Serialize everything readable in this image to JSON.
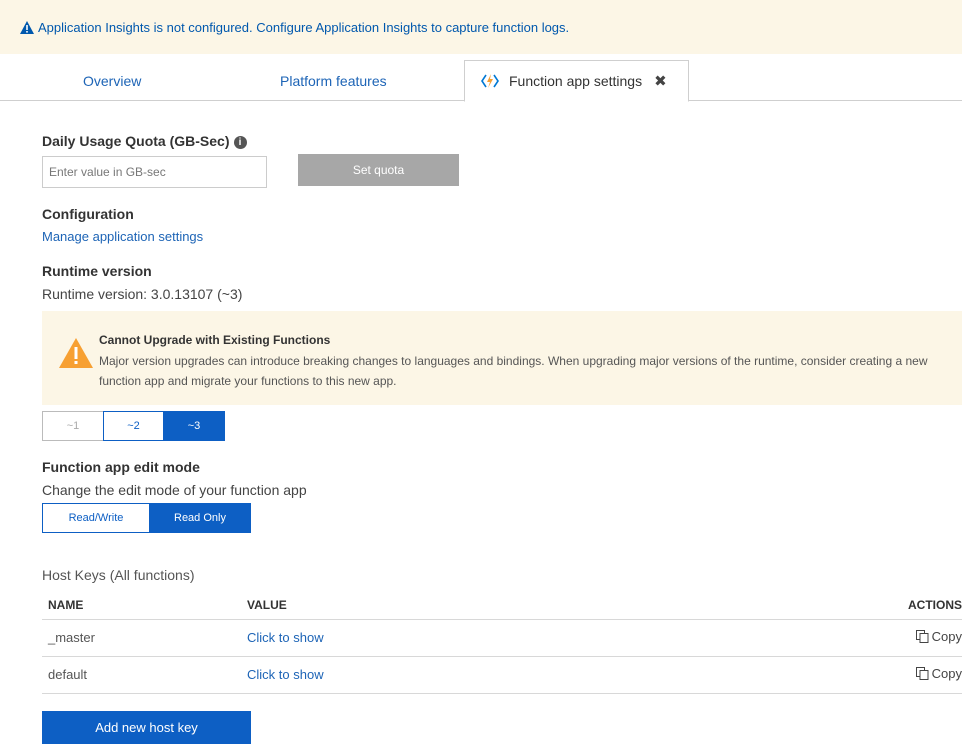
{
  "banner": {
    "text": "Application Insights is not configured. Configure Application Insights to capture function logs.",
    "icon": "warning-icon"
  },
  "tabs": [
    {
      "label": "Overview"
    },
    {
      "label": "Platform features"
    },
    {
      "label": "Function app settings",
      "icon": "function-app-icon",
      "close_icon": "close-icon"
    }
  ],
  "quota": {
    "label": "Daily Usage Quota (GB-Sec)",
    "placeholder": "Enter value in GB-sec",
    "button": "Set quota"
  },
  "configuration": {
    "label": "Configuration",
    "link": "Manage application settings"
  },
  "runtime": {
    "label": "Runtime version",
    "value": "Runtime version: 3.0.13107 (~3)",
    "warning_title": "Cannot Upgrade with Existing Functions",
    "warning_message": "Major version upgrades can introduce breaking changes to languages and bindings. When upgrading major versions of the runtime, consider creating a new function app and migrate your functions to this new app.",
    "versions": [
      "~1",
      "~2",
      "~3"
    ],
    "selected_version": "~3"
  },
  "edit_mode": {
    "label": "Function app edit mode",
    "description": "Change the edit mode of your function app",
    "options": [
      "Read/Write",
      "Read Only"
    ],
    "selected": "Read Only"
  },
  "host_keys": {
    "title": "Host Keys (All functions)",
    "columns": [
      "NAME",
      "VALUE",
      "ACTIONS"
    ],
    "rows": [
      {
        "name": "_master",
        "value": "Click to show",
        "action": "Copy"
      },
      {
        "name": "default",
        "value": "Click to show",
        "action": "Copy"
      }
    ],
    "add_button": "Add new host key"
  },
  "colors": {
    "accent": "#0d5fc4",
    "banner_bg": "#fcf6e6",
    "warning": "#f7a032"
  }
}
